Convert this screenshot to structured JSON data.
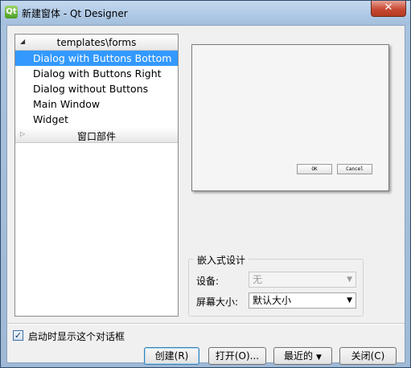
{
  "window": {
    "app_icon": "qt-icon",
    "title": "新建窗体 - Qt Designer",
    "close_symbol": "✕"
  },
  "tree": {
    "groups": [
      {
        "label": "templates\\forms",
        "expanded": true
      },
      {
        "label": "窗口部件",
        "expanded": false
      }
    ],
    "items": [
      "Dialog with Buttons Bottom",
      "Dialog with Buttons Right",
      "Dialog without Buttons",
      "Main Window",
      "Widget"
    ],
    "selected_index": 0
  },
  "preview": {
    "ok_label": "OK",
    "cancel_label": "Cancel"
  },
  "embedded": {
    "title": "嵌入式设计",
    "device_label": "设备:",
    "device_value": "无",
    "screen_label": "屏幕大小:",
    "screen_value": "默认大小"
  },
  "footer": {
    "show_on_startup_label": "启动时显示这个对话框",
    "show_on_startup_checked": true,
    "create_label": "创建(R)",
    "open_label": "打开(O)...",
    "recent_label": "最近的",
    "close_label": "关闭(C)"
  },
  "colors": {
    "selection": "#3399ff",
    "title_bar": "#b9d1ea",
    "close_button": "#c74a33"
  }
}
